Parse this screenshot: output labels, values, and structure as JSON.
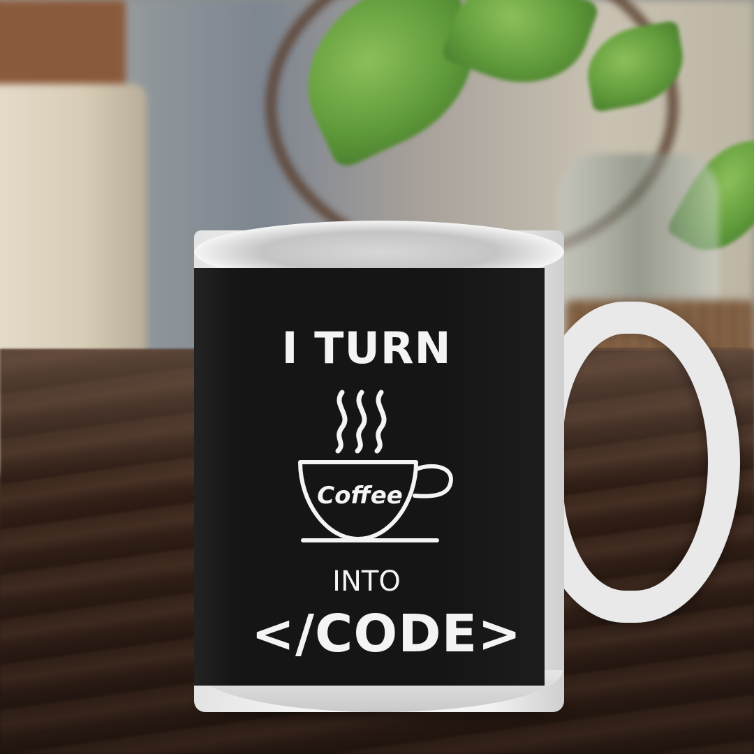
{
  "mug": {
    "line1": "I TURN",
    "cup_label": "Coffee",
    "line3": "INTO",
    "line4": "</CODE>"
  },
  "colors": {
    "mug_print": "#151515",
    "print_text": "#f4f4f4",
    "ceramic": "#f0f0f0",
    "table_wood": "#3b271c"
  },
  "icons": [
    "steam-icon",
    "coffee-cup-icon"
  ]
}
